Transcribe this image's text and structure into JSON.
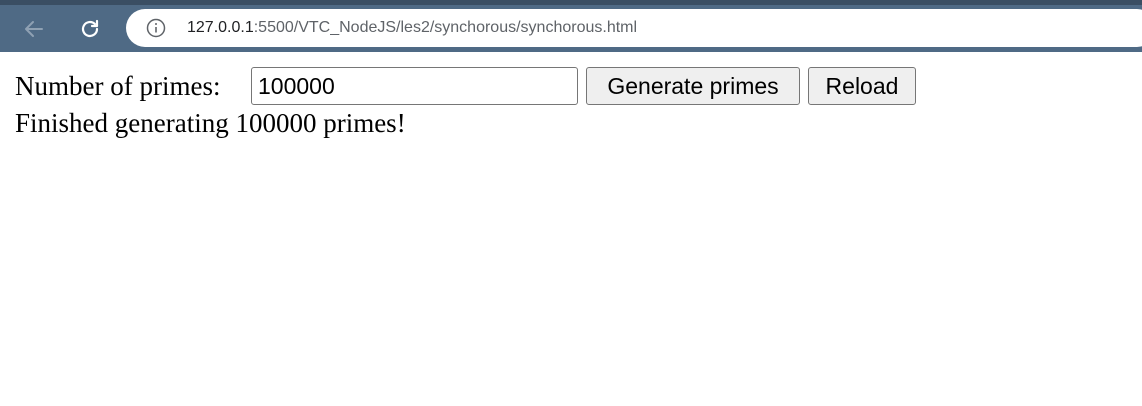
{
  "browser": {
    "url_host": "127.0.0.1",
    "url_path": ":5500/VTC_NodeJS/les2/synchorous/synchorous.html",
    "back_icon": "arrow-left-icon",
    "reload_icon": "reload-icon",
    "site_info_icon": "info-icon"
  },
  "form": {
    "label": "Number of primes:",
    "input_value": "100000",
    "generate_label": "Generate primes",
    "reload_label": "Reload"
  },
  "status": {
    "message": "Finished generating 100000 primes!"
  },
  "colors": {
    "chrome_bg": "#4f6a85",
    "chrome_top": "#3a4e63",
    "button_bg": "#efefef",
    "input_border": "#767676"
  }
}
